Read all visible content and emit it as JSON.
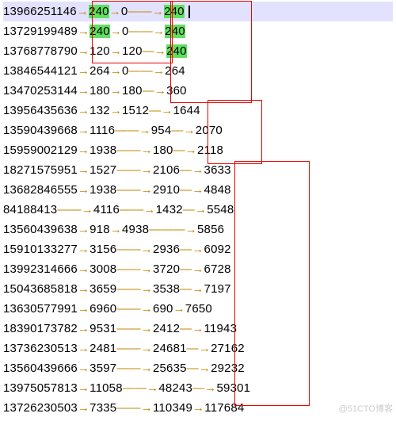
{
  "watermark": "@51CTO博客",
  "boxes": [
    "group-1",
    "group-2",
    "group-3",
    "group-4"
  ],
  "lines": [
    {
      "selected": true,
      "caret": true,
      "tokens": [
        {
          "t": "13966251146"
        },
        {
          "t": "→",
          "c": "arrow"
        },
        {
          "t": "240",
          "c": "hl"
        },
        {
          "t": "→",
          "c": "arrow"
        },
        {
          "t": "0"
        },
        {
          "t": "——→",
          "c": "arrow"
        },
        {
          "t": "240",
          "c": "hl"
        }
      ]
    },
    {
      "selected": false,
      "caret": false,
      "tokens": [
        {
          "t": "13729199489"
        },
        {
          "t": "→",
          "c": "arrow"
        },
        {
          "t": "240",
          "c": "hl"
        },
        {
          "t": "→",
          "c": "arrow"
        },
        {
          "t": "0"
        },
        {
          "t": "——→",
          "c": "arrow"
        },
        {
          "t": "240",
          "c": "hl"
        }
      ]
    },
    {
      "selected": false,
      "caret": false,
      "tokens": [
        {
          "t": "13768778790"
        },
        {
          "t": "→",
          "c": "arrow"
        },
        {
          "t": "120"
        },
        {
          "t": "→",
          "c": "arrow"
        },
        {
          "t": "120"
        },
        {
          "t": "—→",
          "c": "arrow"
        },
        {
          "t": "240",
          "c": "hl"
        }
      ]
    },
    {
      "selected": false,
      "caret": false,
      "tokens": [
        {
          "t": "13846544121"
        },
        {
          "t": "→",
          "c": "arrow"
        },
        {
          "t": "264"
        },
        {
          "t": "→",
          "c": "arrow"
        },
        {
          "t": "0"
        },
        {
          "t": "——→",
          "c": "arrow"
        },
        {
          "t": "264"
        }
      ]
    },
    {
      "selected": false,
      "caret": false,
      "tokens": [
        {
          "t": "13470253144"
        },
        {
          "t": "→",
          "c": "arrow"
        },
        {
          "t": "180"
        },
        {
          "t": "→",
          "c": "arrow"
        },
        {
          "t": "180"
        },
        {
          "t": "—→",
          "c": "arrow"
        },
        {
          "t": "360"
        }
      ]
    },
    {
      "selected": false,
      "caret": false,
      "tokens": [
        {
          "t": "13956435636"
        },
        {
          "t": "→",
          "c": "arrow"
        },
        {
          "t": "132"
        },
        {
          "t": "→",
          "c": "arrow"
        },
        {
          "t": "1512"
        },
        {
          "t": "—→",
          "c": "arrow"
        },
        {
          "t": "1644"
        }
      ]
    },
    {
      "selected": false,
      "caret": false,
      "tokens": [
        {
          "t": "13590439668"
        },
        {
          "t": "→",
          "c": "arrow"
        },
        {
          "t": "1116"
        },
        {
          "t": "——→",
          "c": "arrow"
        },
        {
          "t": "954"
        },
        {
          "t": "—→",
          "c": "arrow"
        },
        {
          "t": "2070"
        }
      ]
    },
    {
      "selected": false,
      "caret": false,
      "tokens": [
        {
          "t": "15959002129"
        },
        {
          "t": "→",
          "c": "arrow"
        },
        {
          "t": "1938"
        },
        {
          "t": "——→",
          "c": "arrow"
        },
        {
          "t": "180"
        },
        {
          "t": "—→",
          "c": "arrow"
        },
        {
          "t": "2118"
        }
      ]
    },
    {
      "selected": false,
      "caret": false,
      "tokens": [
        {
          "t": "18271575951"
        },
        {
          "t": "→",
          "c": "arrow"
        },
        {
          "t": "1527"
        },
        {
          "t": "——→",
          "c": "arrow"
        },
        {
          "t": "2106"
        },
        {
          "t": "—→",
          "c": "arrow"
        },
        {
          "t": "3633"
        }
      ]
    },
    {
      "selected": false,
      "caret": false,
      "tokens": [
        {
          "t": "13682846555"
        },
        {
          "t": "→",
          "c": "arrow"
        },
        {
          "t": "1938"
        },
        {
          "t": "——→",
          "c": "arrow"
        },
        {
          "t": "2910"
        },
        {
          "t": "—→",
          "c": "arrow"
        },
        {
          "t": "4848"
        }
      ]
    },
    {
      "selected": false,
      "caret": false,
      "tokens": [
        {
          "t": "84188413"
        },
        {
          "t": "——→",
          "c": "arrow"
        },
        {
          "t": "4116"
        },
        {
          "t": "——→",
          "c": "arrow"
        },
        {
          "t": "1432"
        },
        {
          "t": "—→",
          "c": "arrow"
        },
        {
          "t": "5548"
        }
      ]
    },
    {
      "selected": false,
      "caret": false,
      "tokens": [
        {
          "t": "13560439638"
        },
        {
          "t": "→",
          "c": "arrow"
        },
        {
          "t": "918"
        },
        {
          "t": "→",
          "c": "arrow"
        },
        {
          "t": "4938"
        },
        {
          "t": "———→",
          "c": "arrow"
        },
        {
          "t": "5856"
        }
      ]
    },
    {
      "selected": false,
      "caret": false,
      "tokens": [
        {
          "t": "15910133277"
        },
        {
          "t": "→",
          "c": "arrow"
        },
        {
          "t": "3156"
        },
        {
          "t": "——→",
          "c": "arrow"
        },
        {
          "t": "2936"
        },
        {
          "t": "—→",
          "c": "arrow"
        },
        {
          "t": "6092"
        }
      ]
    },
    {
      "selected": false,
      "caret": false,
      "tokens": [
        {
          "t": "13992314666"
        },
        {
          "t": "→",
          "c": "arrow"
        },
        {
          "t": "3008"
        },
        {
          "t": "——→",
          "c": "arrow"
        },
        {
          "t": "3720"
        },
        {
          "t": "—→",
          "c": "arrow"
        },
        {
          "t": "6728"
        }
      ]
    },
    {
      "selected": false,
      "caret": false,
      "tokens": [
        {
          "t": "15043685818"
        },
        {
          "t": "→",
          "c": "arrow"
        },
        {
          "t": "3659"
        },
        {
          "t": "——→",
          "c": "arrow"
        },
        {
          "t": "3538"
        },
        {
          "t": "—→",
          "c": "arrow"
        },
        {
          "t": "7197"
        }
      ]
    },
    {
      "selected": false,
      "caret": false,
      "tokens": [
        {
          "t": "13630577991"
        },
        {
          "t": "→",
          "c": "arrow"
        },
        {
          "t": "6960"
        },
        {
          "t": "——→",
          "c": "arrow"
        },
        {
          "t": "690"
        },
        {
          "t": "→",
          "c": "arrow"
        },
        {
          "t": "7650"
        }
      ]
    },
    {
      "selected": false,
      "caret": false,
      "tokens": [
        {
          "t": "18390173782"
        },
        {
          "t": "→",
          "c": "arrow"
        },
        {
          "t": "9531"
        },
        {
          "t": "——→",
          "c": "arrow"
        },
        {
          "t": "2412"
        },
        {
          "t": "—→",
          "c": "arrow"
        },
        {
          "t": "11943"
        }
      ]
    },
    {
      "selected": false,
      "caret": false,
      "tokens": [
        {
          "t": "13736230513"
        },
        {
          "t": "→",
          "c": "arrow"
        },
        {
          "t": "2481"
        },
        {
          "t": "——→",
          "c": "arrow"
        },
        {
          "t": "24681"
        },
        {
          "t": "—→",
          "c": "arrow"
        },
        {
          "t": "27162"
        }
      ]
    },
    {
      "selected": false,
      "caret": false,
      "tokens": [
        {
          "t": "13560439666"
        },
        {
          "t": "→",
          "c": "arrow"
        },
        {
          "t": "3597"
        },
        {
          "t": "——→",
          "c": "arrow"
        },
        {
          "t": "25635"
        },
        {
          "t": "—→",
          "c": "arrow"
        },
        {
          "t": "29232"
        }
      ]
    },
    {
      "selected": false,
      "caret": false,
      "tokens": [
        {
          "t": "13975057813"
        },
        {
          "t": "→",
          "c": "arrow"
        },
        {
          "t": "11058"
        },
        {
          "t": "——→",
          "c": "arrow"
        },
        {
          "t": "48243"
        },
        {
          "t": "—→",
          "c": "arrow"
        },
        {
          "t": "59301"
        }
      ]
    },
    {
      "selected": false,
      "caret": false,
      "tokens": [
        {
          "t": "13726230503"
        },
        {
          "t": "→",
          "c": "arrow"
        },
        {
          "t": "7335"
        },
        {
          "t": "——→",
          "c": "arrow"
        },
        {
          "t": "110349"
        },
        {
          "t": "→",
          "c": "arrow"
        },
        {
          "t": "117684"
        }
      ]
    }
  ]
}
